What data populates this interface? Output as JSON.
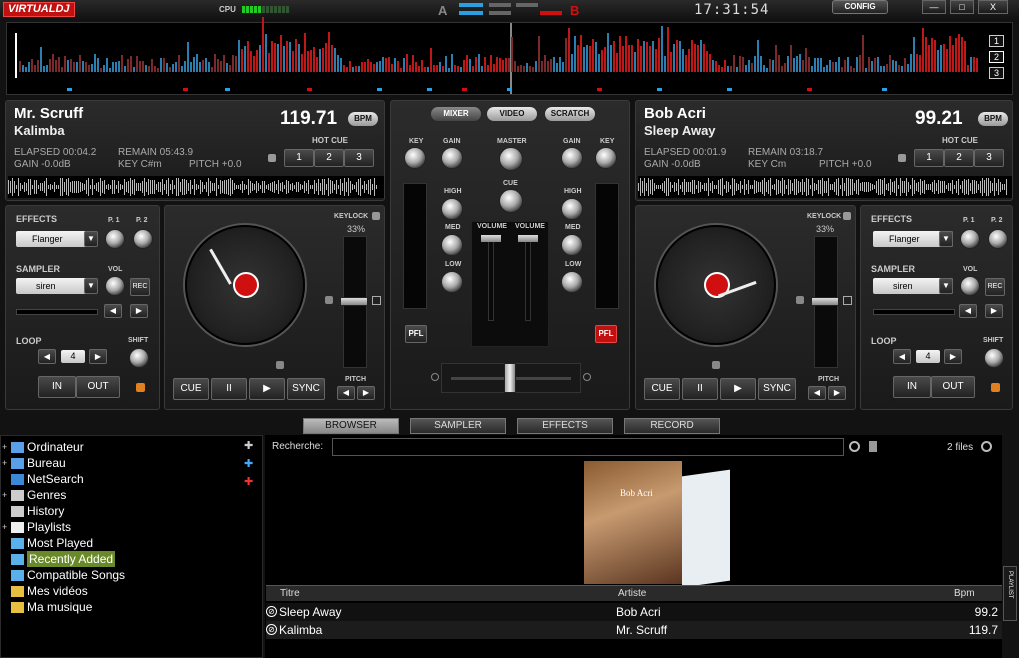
{
  "app": {
    "logo": "VIRTUALDJ",
    "cpu_label": "CPU",
    "deck_a": "A",
    "deck_b": "B",
    "clock": "17:31:54",
    "config": "CONFIG",
    "min": "—",
    "max": "□",
    "close": "X"
  },
  "overview": {
    "nums": [
      "1",
      "2",
      "3"
    ]
  },
  "left": {
    "title": "Mr. Scruff",
    "artist": "Kalimba",
    "bpm": "119.71",
    "bpm_badge": "BPM",
    "elapsed": "ELAPSED 00:04.2",
    "remain": "REMAIN 05:43.9",
    "gain": "GAIN -0.0dB",
    "key": "KEY C#m",
    "pitch": "PITCH +0.0",
    "hotcue": "HOT CUE",
    "hc": [
      "1",
      "2",
      "3"
    ],
    "effects": "EFFECTS",
    "p1": "P. 1",
    "p2": "P. 2",
    "effect": "Flanger",
    "sampler": "SAMPLER",
    "vol": "VOL",
    "sample": "siren",
    "rec": "REC",
    "loop": "LOOP",
    "loop_val": "4",
    "shift": "SHIFT",
    "in": "IN",
    "out": "OUT",
    "keylock": "KEYLOCK",
    "pct": "33%",
    "pitch_lbl": "PITCH",
    "cue": "CUE",
    "pause": "II",
    "play": "▶",
    "sync": "SYNC"
  },
  "right": {
    "title": "Bob Acri",
    "artist": "Sleep Away",
    "bpm": "99.21",
    "bpm_badge": "BPM",
    "elapsed": "ELAPSED 00:01.9",
    "remain": "REMAIN 03:18.7",
    "gain": "GAIN -0.0dB",
    "key": "KEY Cm",
    "pitch": "PITCH +0.0",
    "hotcue": "HOT CUE",
    "hc": [
      "1",
      "2",
      "3"
    ],
    "effects": "EFFECTS",
    "p1": "P. 1",
    "p2": "P. 2",
    "effect": "Flanger",
    "sampler": "SAMPLER",
    "vol": "VOL",
    "sample": "siren",
    "rec": "REC",
    "loop": "LOOP",
    "loop_val": "4",
    "shift": "SHIFT",
    "in": "IN",
    "out": "OUT",
    "keylock": "KEYLOCK",
    "pct": "33%",
    "pitch_lbl": "PITCH",
    "cue": "CUE",
    "pause": "II",
    "play": "▶",
    "sync": "SYNC"
  },
  "mixer": {
    "tabs": [
      "MIXER",
      "VIDEO",
      "SCRATCH"
    ],
    "key": "KEY",
    "gain": "GAIN",
    "master": "MASTER",
    "cue": "CUE",
    "high": "HIGH",
    "med": "MED",
    "low": "LOW",
    "volume": "VOLUME",
    "pfl": "PFL"
  },
  "browser": {
    "tabs": [
      "BROWSER",
      "SAMPLER",
      "EFFECTS",
      "RECORD"
    ],
    "tree": [
      "Ordinateur",
      "Bureau",
      "NetSearch",
      "Genres",
      "History",
      "Playlists",
      "Most Played",
      "Recently Added",
      "Compatible Songs",
      "Mes vidéos",
      "Ma musique"
    ],
    "search_label": "Recherche:",
    "search_value": "",
    "files": "2 files",
    "side_tab": "PLAYLIST",
    "cover_text": "Bob Acri",
    "cols": [
      "Titre",
      "Artiste",
      "Bpm"
    ],
    "rows": [
      {
        "title": "Sleep Away",
        "artist": "Bob Acri",
        "bpm": "99.2"
      },
      {
        "title": "Kalimba",
        "artist": "Mr. Scruff",
        "bpm": "119.7"
      }
    ]
  },
  "colors": {
    "accent": "#d01010",
    "blue": "#2aa0e0",
    "green": "#2c2",
    "selected": "#6a8a2a"
  }
}
